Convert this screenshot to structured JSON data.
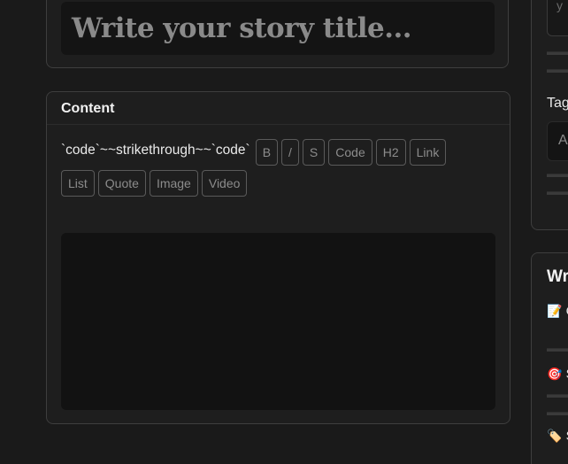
{
  "title_input": {
    "placeholder": "Write your story title..."
  },
  "content": {
    "heading": "Content",
    "preview_text": "`code`~~strikethrough~~`code`",
    "toolbar": [
      {
        "id": "bold",
        "label": "B"
      },
      {
        "id": "italic",
        "label": "/"
      },
      {
        "id": "strike",
        "label": "S"
      },
      {
        "id": "code",
        "label": "Code"
      },
      {
        "id": "h2",
        "label": "H2"
      },
      {
        "id": "link",
        "label": "Link"
      },
      {
        "id": "list",
        "label": "List"
      },
      {
        "id": "quote",
        "label": "Quote"
      },
      {
        "id": "image",
        "label": "Image"
      },
      {
        "id": "video",
        "label": "Video"
      }
    ]
  },
  "sidebar": {
    "top_input_fragment": "y",
    "tags_label_fragment": "Tag",
    "tags_input_fragment": "A",
    "bottom_heading_fragment": "Wr",
    "tips": [
      {
        "emoji": "📝",
        "text_fragment": "C"
      },
      {
        "emoji": "🎯",
        "text_fragment": "S"
      },
      {
        "emoji": "🏷️",
        "text_fragment": "S"
      }
    ]
  }
}
